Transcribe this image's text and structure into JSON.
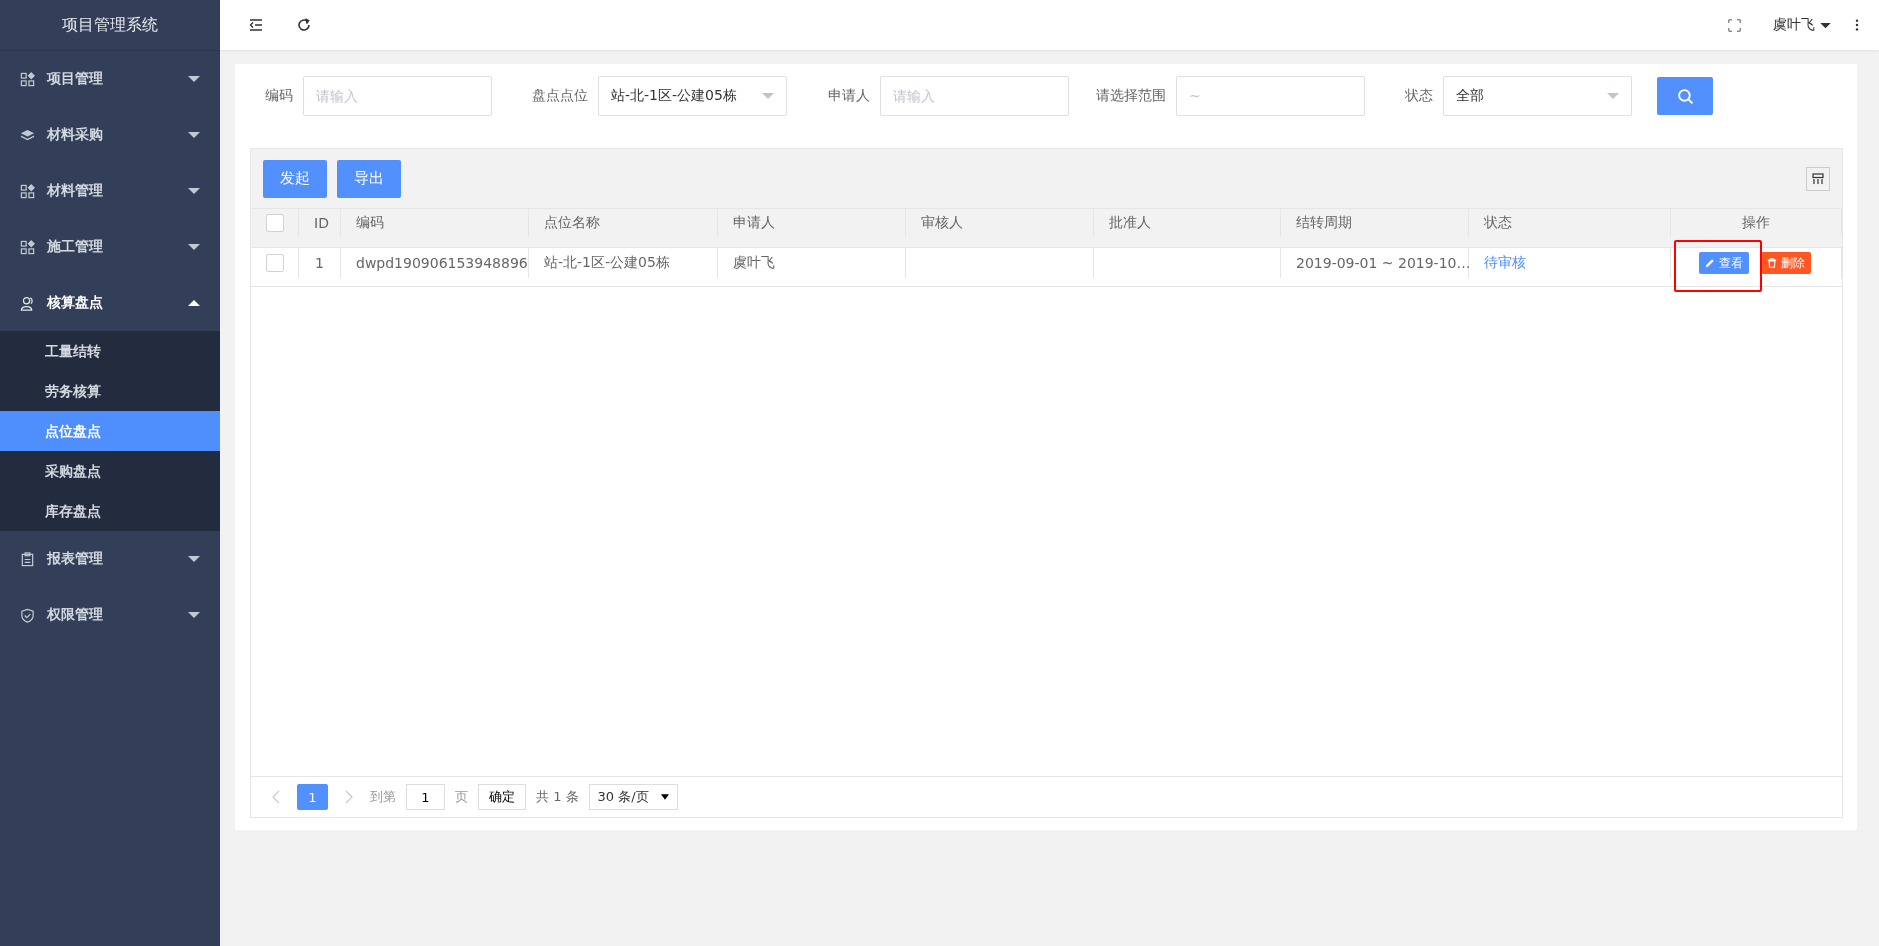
{
  "sidebar": {
    "title": "项目管理系统",
    "items": [
      {
        "label": "项目管理",
        "kind": "grid",
        "expanded": false
      },
      {
        "label": "材料采购",
        "kind": "layers",
        "expanded": false
      },
      {
        "label": "材料管理",
        "kind": "grid",
        "expanded": false
      },
      {
        "label": "施工管理",
        "kind": "grid",
        "expanded": false
      },
      {
        "label": "核算盘点",
        "kind": "user",
        "expanded": true,
        "children": [
          {
            "label": "工量结转",
            "selected": false
          },
          {
            "label": "劳务核算",
            "selected": false
          },
          {
            "label": "点位盘点",
            "selected": true
          },
          {
            "label": "采购盘点",
            "selected": false
          },
          {
            "label": "库存盘点",
            "selected": false
          }
        ]
      },
      {
        "label": "报表管理",
        "kind": "clipboard",
        "expanded": false
      },
      {
        "label": "权限管理",
        "kind": "shield",
        "expanded": false
      }
    ]
  },
  "topbar": {
    "user": "虞叶飞"
  },
  "filters": [
    {
      "kind": "input",
      "label": "编码",
      "placeholder": "请输入"
    },
    {
      "kind": "select",
      "label": "盘点点位",
      "value": "站-北-1区-公建05栋"
    },
    {
      "kind": "input",
      "label": "申请人",
      "placeholder": "请输入"
    },
    {
      "kind": "input",
      "label": "请选择范围",
      "placeholder": "~"
    },
    {
      "kind": "select",
      "label": "状态",
      "value": "全部"
    }
  ],
  "toolbar": {
    "buttons": [
      "发起",
      "导出"
    ]
  },
  "table": {
    "all_checked": false,
    "columns": [
      "ID",
      "编码",
      "点位名称",
      "申请人",
      "审核人",
      "批准人",
      "结转周期",
      "状态",
      "操作"
    ],
    "rows": [
      {
        "checked": false,
        "cells": [
          "1",
          "dwpd190906153948896",
          "站-北-1区-公建05栋",
          "虞叶飞",
          "",
          "",
          "2019-09-01 ~ 2019-10…",
          "待审核"
        ],
        "actions": [
          {
            "kind": "view",
            "label": "查看",
            "highlighted": true
          },
          {
            "kind": "delete",
            "label": "删除",
            "highlighted": false
          }
        ]
      }
    ]
  },
  "pagination": {
    "pages": [
      {
        "label": "1",
        "selected": true
      }
    ],
    "goto_label": "到第",
    "goto_value": "1",
    "page_unit": "页",
    "confirm": "确定",
    "total": "共 1 条",
    "page_size": "30 条/页"
  }
}
